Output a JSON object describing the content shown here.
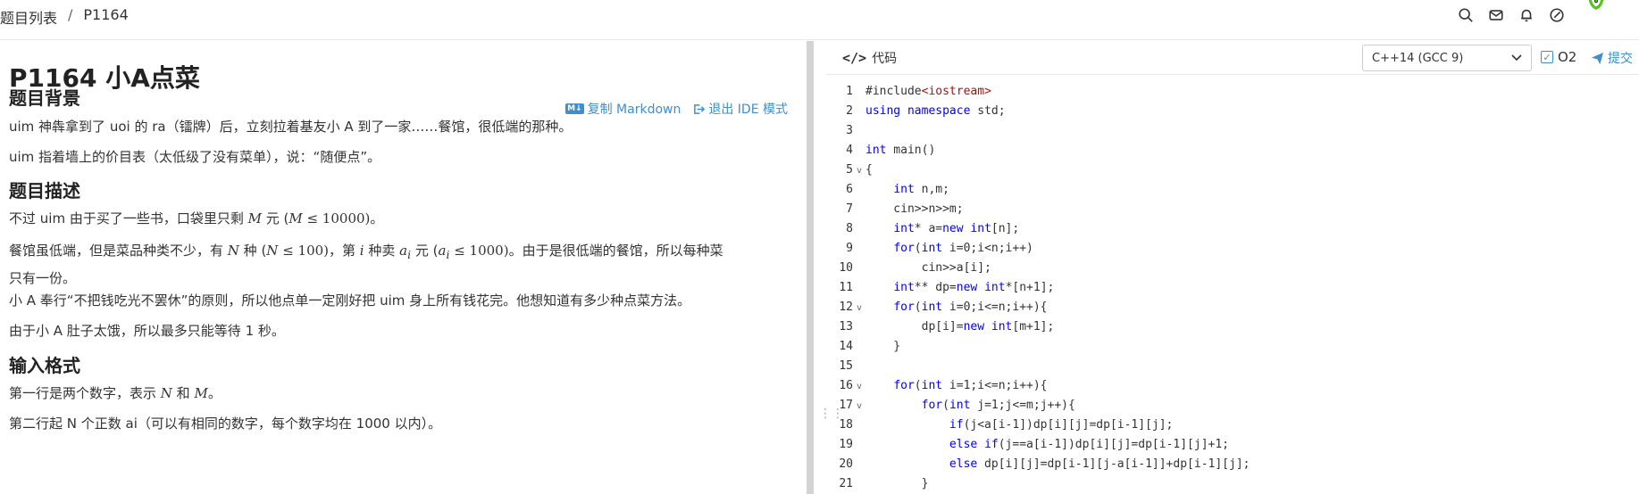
{
  "breadcrumb": {
    "root": "题目列表",
    "sep": "/",
    "current": "P1164"
  },
  "problem": {
    "title": "P1164 小A点菜",
    "copy_markdown": "复制 Markdown",
    "md_badge": "M↓",
    "exit_ide": "退出 IDE 模式",
    "sections": {
      "background": "题目背景",
      "description": "题目描述",
      "input": "输入格式"
    },
    "bg_p1": "uim 神犇拿到了 uoi 的 ra（镭牌）后，立刻拉着基友小 A 到了一家……餐馆，很低端的那种。",
    "bg_p2": "uim 指着墙上的价目表（太低级了没有菜单），说：“随便点”。",
    "desc_p1": {
      "a": "不过 uim 由于买了一些书，口袋里只剩 ",
      "m": "M",
      "b": " 元 (",
      "m2": "M",
      "c": " ≤ 10000)。"
    },
    "desc_p2": {
      "a": "餐馆虽低端，但是菜品种类不少，有 ",
      "n": "N",
      "b": " 种 (",
      "n2": "N",
      "c": " ≤ 100)，第 ",
      "i": "i",
      "d": " 种卖 ",
      "ai": "a",
      "sub": "i",
      "e": " 元 (",
      "ai2": "a",
      "sub2": "i",
      "f": " ≤ 1000)。由于是很低端的餐馆，所以每种菜",
      "g": "只有一份。"
    },
    "desc_p3": "小 A 奉行“不把钱吃光不罢休”的原则，所以他点单一定刚好把 uim 身上所有钱花完。他想知道有多少种点菜方法。",
    "desc_p4": "由于小 A 肚子太饿，所以最多只能等待 1 秒。",
    "input_p1": {
      "a": "第一行是两个数字，表示 ",
      "n": "N",
      "b": " 和 ",
      "m": "M",
      "c": "。"
    },
    "input_p2": "第二行起 N 个正数 ai（可以有相同的数字，每个数字均在 1000 以内）。"
  },
  "editor": {
    "tab_icon": "</>",
    "tab_label": "代码",
    "language": "C++14 (GCC 9)",
    "o2_label": "O2",
    "submit_label": "提交",
    "lines": [
      {
        "n": "1",
        "fold": "",
        "code": "#include<iostream>"
      },
      {
        "n": "2",
        "fold": "",
        "code": "using namespace std;"
      },
      {
        "n": "3",
        "fold": "",
        "code": ""
      },
      {
        "n": "4",
        "fold": "",
        "code": "int main()"
      },
      {
        "n": "5",
        "fold": "v",
        "code": "{"
      },
      {
        "n": "6",
        "fold": "",
        "code": "    int n,m;"
      },
      {
        "n": "7",
        "fold": "",
        "code": "    cin>>n>>m;"
      },
      {
        "n": "8",
        "fold": "",
        "code": "    int* a=new int[n];"
      },
      {
        "n": "9",
        "fold": "",
        "code": "    for(int i=0;i<n;i++)"
      },
      {
        "n": "10",
        "fold": "",
        "code": "        cin>>a[i];"
      },
      {
        "n": "11",
        "fold": "",
        "code": "    int** dp=new int*[n+1];"
      },
      {
        "n": "12",
        "fold": "v",
        "code": "    for(int i=0;i<=n;i++){"
      },
      {
        "n": "13",
        "fold": "",
        "code": "        dp[i]=new int[m+1];"
      },
      {
        "n": "14",
        "fold": "",
        "code": "    }"
      },
      {
        "n": "15",
        "fold": "",
        "code": ""
      },
      {
        "n": "16",
        "fold": "v",
        "code": "    for(int i=1;i<=n;i++){"
      },
      {
        "n": "17",
        "fold": "v",
        "code": "        for(int j=1;j<=m;j++){"
      },
      {
        "n": "18",
        "fold": "",
        "code": "            if(j<a[i-1])dp[i][j]=dp[i-1][j];"
      },
      {
        "n": "19",
        "fold": "",
        "code": "            else if(j==a[i-1])dp[i][j]=dp[i-1][j]+1;"
      },
      {
        "n": "20",
        "fold": "",
        "code": "            else dp[i][j]=dp[i-1][j-a[i-1]]+dp[i-1][j];"
      },
      {
        "n": "21",
        "fold": "",
        "code": "        }"
      }
    ]
  },
  "colors": {
    "accent": "#3e8ed0",
    "keyword": "#0000ff",
    "include": "#a31515",
    "avatar": "#52c41a"
  }
}
